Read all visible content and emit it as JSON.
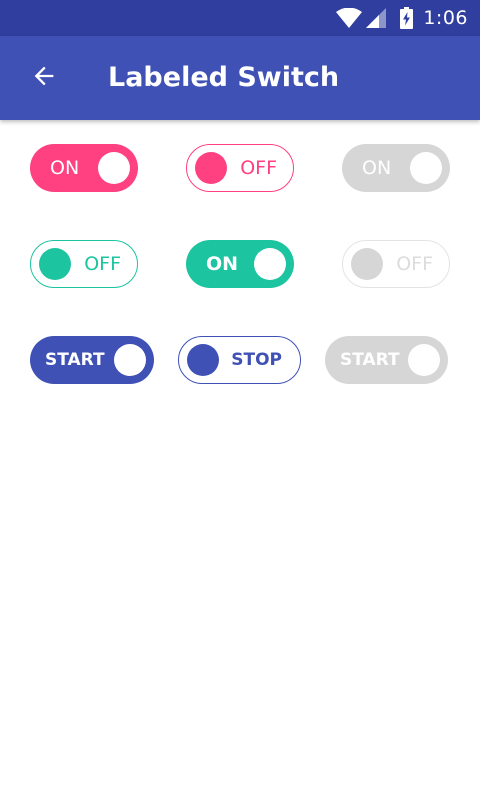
{
  "status_bar": {
    "time": "1:06"
  },
  "app_bar": {
    "title": "Labeled Switch"
  },
  "rows": [
    [
      {
        "label": "ON",
        "state": "on",
        "enabled": true,
        "color": "#ff4081"
      },
      {
        "label": "OFF",
        "state": "off",
        "enabled": true,
        "color": "#ff4081"
      },
      {
        "label": "ON",
        "state": "on",
        "enabled": false,
        "color": "#d6d6d6"
      }
    ],
    [
      {
        "label": "OFF",
        "state": "off",
        "enabled": true,
        "color": "#1dc4a0"
      },
      {
        "label": "ON",
        "state": "on",
        "enabled": true,
        "color": "#1dc4a0"
      },
      {
        "label": "OFF",
        "state": "off",
        "enabled": false,
        "color": "#d6d6d6"
      }
    ],
    [
      {
        "label": "START",
        "state": "on",
        "enabled": true,
        "color": "#3f51b5"
      },
      {
        "label": "STOP",
        "state": "off",
        "enabled": true,
        "color": "#3f51b5"
      },
      {
        "label": "START",
        "state": "on",
        "enabled": false,
        "color": "#d6d6d6"
      }
    ]
  ],
  "colors": {
    "primary": "#3f51b5",
    "primary_dark": "#303f9f",
    "pink": "#ff4081",
    "teal": "#1dc4a0",
    "disabled": "#d6d6d6"
  }
}
